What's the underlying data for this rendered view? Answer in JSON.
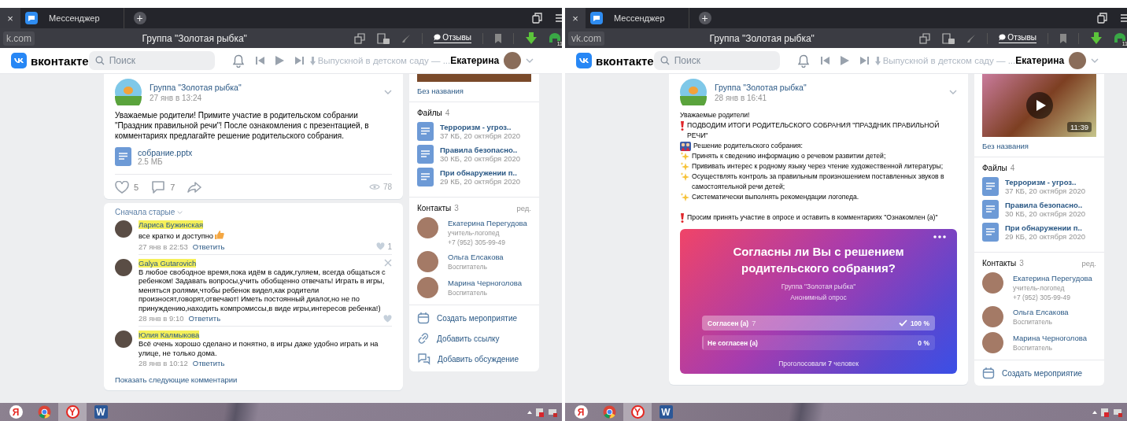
{
  "windows": [
    {
      "previous_tab_close": "×",
      "tabs": [
        {
          "label": "Мессенджер",
          "selected": false
        }
      ],
      "new_tab": "+",
      "address": "k.com",
      "page_title": "Группа \"Золотая рыбка\"",
      "feedback_button": "Отзывы",
      "extension_badge": "11",
      "vk": {
        "logo_text": "вконтакте",
        "search": {
          "placeholder": "Поиск"
        },
        "now_playing": "Выпускной в детском саду — ...",
        "user": "Екатерина"
      },
      "post": {
        "author": "Группа \"Золотая рыбка\"",
        "date": "27 янв в 13:24",
        "paragraphs": [
          [
            {
              "text": "Уважаемые родители! Примите участие в родительском собрании \"Праздник правильной речи\"! После ознакомления с презентацией, в комментариях предлагайте решение родительского собрания."
            }
          ]
        ],
        "attachment": {
          "name": "собрание.pptx",
          "size": "2.5 МБ"
        },
        "likes": "5",
        "comments": "7",
        "views": "78"
      },
      "comments": {
        "sort": "Сначала старые",
        "items": [
          {
            "author": "Лариса Бужинская",
            "text": "все кратко и доступно",
            "kind": "with-emoji",
            "date": "27 янв в 22:53",
            "reply": "Ответить",
            "like_button": true,
            "likes": "1",
            "delete_button": false
          },
          {
            "author": "Galya Gutarovich",
            "text": "В любое свободное время,пока идём в садик,гуляем, всегда общаться с ребенком! Задавать вопросы,учить обобщенно отвечать! Играть в игры, меняться ролями,чтобы ребенок видел,как родители произносят,говорят,отвечают! Иметь постоянный диалог,но не по принуждению,находить компромиссы,в виде игры,интересов ребенка!)",
            "date": "28 янв в 9:10",
            "reply": "Ответить",
            "like_button": true,
            "delete_button": true,
            "kind": "plain"
          },
          {
            "author": "Юлия Калмыкова",
            "text": "Всё очень хорошо сделано и понятно, в игры даже удобно играть и на улице, не только дома.",
            "date": "28 янв в 10:12",
            "reply": "Ответить",
            "like_button": false,
            "delete_button": false,
            "kind": "plain"
          }
        ],
        "more": "Показать следующие комментарии"
      },
      "sidebar": {
        "media": {
          "kind": "photo"
        },
        "caption": "Без названия",
        "files": {
          "title": "Файлы",
          "count": "4",
          "items": [
            {
              "name": "Терроризм - угроз..",
              "meta": "37 КБ, 20 октября 2020"
            },
            {
              "name": "Правила безопасно..",
              "meta": "30 КБ, 20 октября 2020"
            },
            {
              "name": "При обнаружении п..",
              "meta": "29 КБ, 20 октября 2020"
            }
          ]
        },
        "contacts": {
          "title": "Контакты",
          "count": "3",
          "edit": "ред.",
          "items": [
            {
              "name": "Екатерина Перегудова",
              "role": "учитель-логопед",
              "phone": "+7 (952) 305-99-49"
            },
            {
              "name": "Ольга Елсакова",
              "role": "Воспитатель"
            },
            {
              "name": "Марина Черноголова",
              "role": "Воспитатель"
            }
          ]
        },
        "actions": [
          {
            "kind": "event",
            "label": "Создать мероприятие"
          },
          {
            "kind": "link",
            "label": "Добавить ссылку"
          },
          {
            "kind": "discussion",
            "label": "Добавить обсуждение"
          }
        ]
      },
      "taskbar": [
        {
          "kind": "yandex",
          "label": "Я",
          "selected": false
        },
        {
          "kind": "chrome",
          "selected": false
        },
        {
          "kind": "yandex-browser",
          "label": "Y",
          "selected": true
        },
        {
          "kind": "word",
          "label": "W",
          "selected": false
        }
      ]
    },
    {
      "previous_tab_close": "×",
      "tabs": [
        {
          "label": "Мессенджер",
          "selected": false
        }
      ],
      "new_tab": "+",
      "address": "vk.com",
      "page_title": "Группа \"Золотая рыбка\"",
      "feedback_button": "Отзывы",
      "extension_badge": "11",
      "vk": {
        "logo_text": "вконтакте",
        "search": {
          "placeholder": "Поиск"
        },
        "now_playing": "Выпускной в детском саду — ...",
        "user": "Екатерина"
      },
      "post": {
        "author": "Группа \"Золотая рыбка\"",
        "date": "28 янв в 16:41",
        "paragraphs": [
          [
            {
              "text": "Уважаемые родители!"
            }
          ],
          [
            {
              "kind": "exclamation",
              "text": "ПОДВОДИМ ИТОГИ РОДИТЕЛЬСКОГО СОБРАНИЯ \"ПРАЗДНИК ПРАВИЛЬНОЙ РЕЧИ\""
            },
            {
              "kind": "dolls",
              "text": "Решение родительского собрания:"
            }
          ],
          [
            {
              "kind": "sparkles",
              "text": "Принять к сведению информацию о речевом развитии детей;"
            }
          ],
          [
            {
              "kind": "sparkles",
              "text": "Прививать интерес к родному языку через чтение художественной литературы;"
            }
          ],
          [
            {
              "kind": "sparkles",
              "text": "Осуществлять контроль за правильным произношением поставленных звуков в самостоятельной речи детей;"
            }
          ],
          [
            {
              "kind": "sparkles",
              "text": "Систематически выполнять рекомендации логопеда."
            }
          ],
          [
            {
              "kind": "exclamation",
              "text": "Просим принять участие в опросе и оставить в комментариях \"Ознакомлен (а)\""
            }
          ]
        ],
        "poll": {
          "question": "Согласны ли Вы с решением родительского собрания?",
          "group": "Группа \"Золотая рыбка\"",
          "type": "Анонимный опрос",
          "options": [
            {
              "label": "Согласен (а)",
              "count": "7",
              "percent": "100 %",
              "checked": true,
              "level": 1
            },
            {
              "label": "Не согласен (а)",
              "percent": "0 %",
              "checked": false,
              "level": 0
            }
          ],
          "footer": "Проголосовали **7** человек"
        }
      },
      "sidebar": {
        "media": {
          "kind": "video",
          "duration": "11:39"
        },
        "caption": "Без названия",
        "files": {
          "title": "Файлы",
          "count": "4",
          "items": [
            {
              "name": "Терроризм - угроз..",
              "meta": "37 КБ, 20 октября 2020"
            },
            {
              "name": "Правила безопасно..",
              "meta": "30 КБ, 20 октября 2020"
            },
            {
              "name": "При обнаружении п..",
              "meta": "29 КБ, 20 октября 2020"
            }
          ]
        },
        "contacts": {
          "title": "Контакты",
          "count": "3",
          "edit": "ред.",
          "items": [
            {
              "name": "Екатерина Перегудова",
              "role": "учитель-логопед",
              "phone": "+7 (952) 305-99-49"
            },
            {
              "name": "Ольга Елсакова",
              "role": "Воспитатель"
            },
            {
              "name": "Марина Черноголова",
              "role": "Воспитатель"
            }
          ]
        },
        "actions": [
          {
            "kind": "event",
            "label": "Создать мероприятие"
          }
        ]
      },
      "taskbar": [
        {
          "kind": "yandex",
          "label": "Я",
          "selected": false
        },
        {
          "kind": "chrome",
          "selected": false
        },
        {
          "kind": "yandex-browser",
          "label": "Y",
          "selected": true
        },
        {
          "kind": "word",
          "label": "W",
          "selected": false
        }
      ]
    }
  ]
}
